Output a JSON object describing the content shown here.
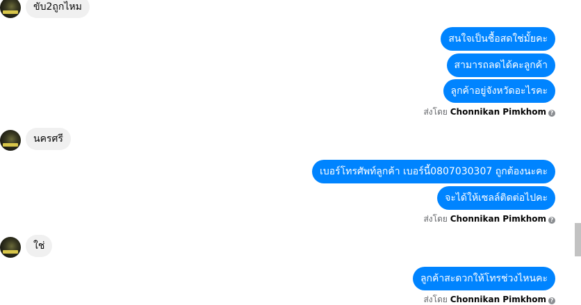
{
  "incoming": [
    {
      "text": "ขับ2ถูกไหม"
    },
    {
      "text": "นครศรี"
    },
    {
      "text": "ใช่"
    }
  ],
  "outgoing": [
    {
      "text": "สนใจเป็นชื้อสดใช่มั้ยคะ"
    },
    {
      "text": "สามารถลดได้คะลูกค้า"
    },
    {
      "text": "ลูกค้าอยู่จังหวัดอะไรคะ"
    },
    {
      "text": "เบอร์โทรศัพท์ลูกค้า เบอร์นี้0807030307 ถูกต้องนะคะ"
    },
    {
      "text": "จะได้ให้เซลล์ติดต่อไปคะ"
    },
    {
      "text": "ลูกค้าสะดวกให้โทรช่วงไหนคะ"
    }
  ],
  "sent_by": {
    "prefix": "ส่งโดย",
    "name": "Chonnikan Pimkhom",
    "help_icon": "?"
  },
  "colors": {
    "outgoing_bubble": "#0084ff",
    "incoming_bubble": "#f0f0f0"
  }
}
